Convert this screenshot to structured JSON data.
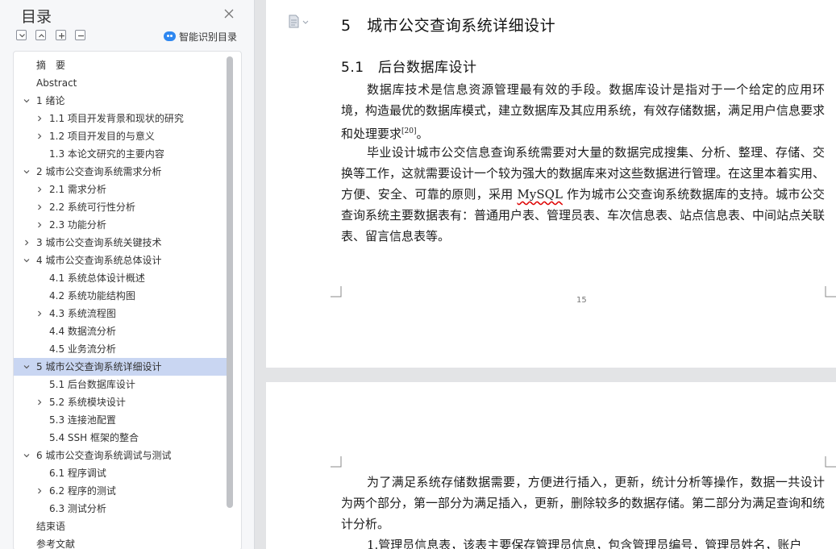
{
  "toc": {
    "title": "目录",
    "smart_toc_label": "智能识别目录",
    "items": [
      {
        "label": "摘　要",
        "level": 0,
        "expander": "none"
      },
      {
        "label": "Abstract",
        "level": 0,
        "expander": "none"
      },
      {
        "label": "1  绪论",
        "level": 1,
        "expander": "expanded"
      },
      {
        "label": "1.1  项目开发背景和现状的研究",
        "level": 2,
        "expander": "collapsed"
      },
      {
        "label": "1.2  项目开发目的与意义",
        "level": 2,
        "expander": "collapsed"
      },
      {
        "label": "1.3  本论文研究的主要内容",
        "level": 2,
        "expander": "none"
      },
      {
        "label": "2  城市公交查询系统需求分析",
        "level": 1,
        "expander": "expanded"
      },
      {
        "label": "2.1  需求分析",
        "level": 2,
        "expander": "collapsed"
      },
      {
        "label": "2.2  系统可行性分析",
        "level": 2,
        "expander": "collapsed"
      },
      {
        "label": "2.3  功能分析",
        "level": 2,
        "expander": "collapsed"
      },
      {
        "label": "3  城市公交查询系统关键技术",
        "level": 1,
        "expander": "collapsed"
      },
      {
        "label": "4  城市公交查询系统总体设计",
        "level": 1,
        "expander": "expanded"
      },
      {
        "label": "4.1  系统总体设计概述",
        "level": 2,
        "expander": "none"
      },
      {
        "label": "4.2  系统功能结构图",
        "level": 2,
        "expander": "none"
      },
      {
        "label": "4.3  系统流程图",
        "level": 2,
        "expander": "collapsed"
      },
      {
        "label": "4.4  数据流分析",
        "level": 2,
        "expander": "none"
      },
      {
        "label": "4.5  业务流分析",
        "level": 2,
        "expander": "none"
      },
      {
        "label": "5  城市公交查询系统详细设计",
        "level": 1,
        "expander": "expanded",
        "selected": true
      },
      {
        "label": "5.1  后台数据库设计",
        "level": 2,
        "expander": "none"
      },
      {
        "label": "5.2  系统模块设计",
        "level": 2,
        "expander": "collapsed"
      },
      {
        "label": "5.3  连接池配置",
        "level": 2,
        "expander": "none"
      },
      {
        "label": "5.4  SSH 框架的整合",
        "level": 2,
        "expander": "none"
      },
      {
        "label": "6  城市公交查询系统调试与测试",
        "level": 1,
        "expander": "expanded"
      },
      {
        "label": "6.1  程序调试",
        "level": 2,
        "expander": "none"
      },
      {
        "label": "6.2  程序的测试",
        "level": 2,
        "expander": "collapsed"
      },
      {
        "label": "6.3  测试分析",
        "level": 2,
        "expander": "none"
      },
      {
        "label": "结束语",
        "level": 0,
        "expander": "none"
      },
      {
        "label": "参考文献",
        "level": 0,
        "expander": "none"
      }
    ]
  },
  "document": {
    "heading1": "5　城市公交查询系统详细设计",
    "heading2": "5.1　后台数据库设计",
    "p1_main": "数据库技术是信息资源管理最有效的手段。数据库设计是指对于一个给定的应用环境，构造最优的数据库模式，建立数据库及其应用系统，有效存储数据，满足用户信息要求和处理要求",
    "p1_cite": "[20]",
    "p1_end": "。",
    "p2_a": "毕业设计城市公交信息查询系统需要对大量的数据完成搜集、分析、整理、存储、交换等工作，这就需要设计一个较为强大的数据库来对这些数据进行管理。在这里本着实用、方便、安全、可靠的原则，采用 ",
    "p2_mysql": "MySQL",
    "p2_b": " 作为城市公交查询系统数据库的支持。城市公交查询系统主要数据表有：普通用户表、管理员表、车次信息表、站点信息表、中间站点关联表、留言信息表等。",
    "page_number": "15",
    "p3": "为了满足系统存储数据需要，方便进行插入，更新，统计分析等操作，数据一共设计为两个部分，第一部分为满足插入，更新，删除较多的数据存储。第二部分为满足查询和统计分析。",
    "p4": "1.管理员信息表，该表主要保存管理员信息，包含管理员编号，管理员姓名，账户"
  },
  "colors": {
    "selected_row": "#c9d6f2",
    "accent_blue": "#2e87f0"
  }
}
